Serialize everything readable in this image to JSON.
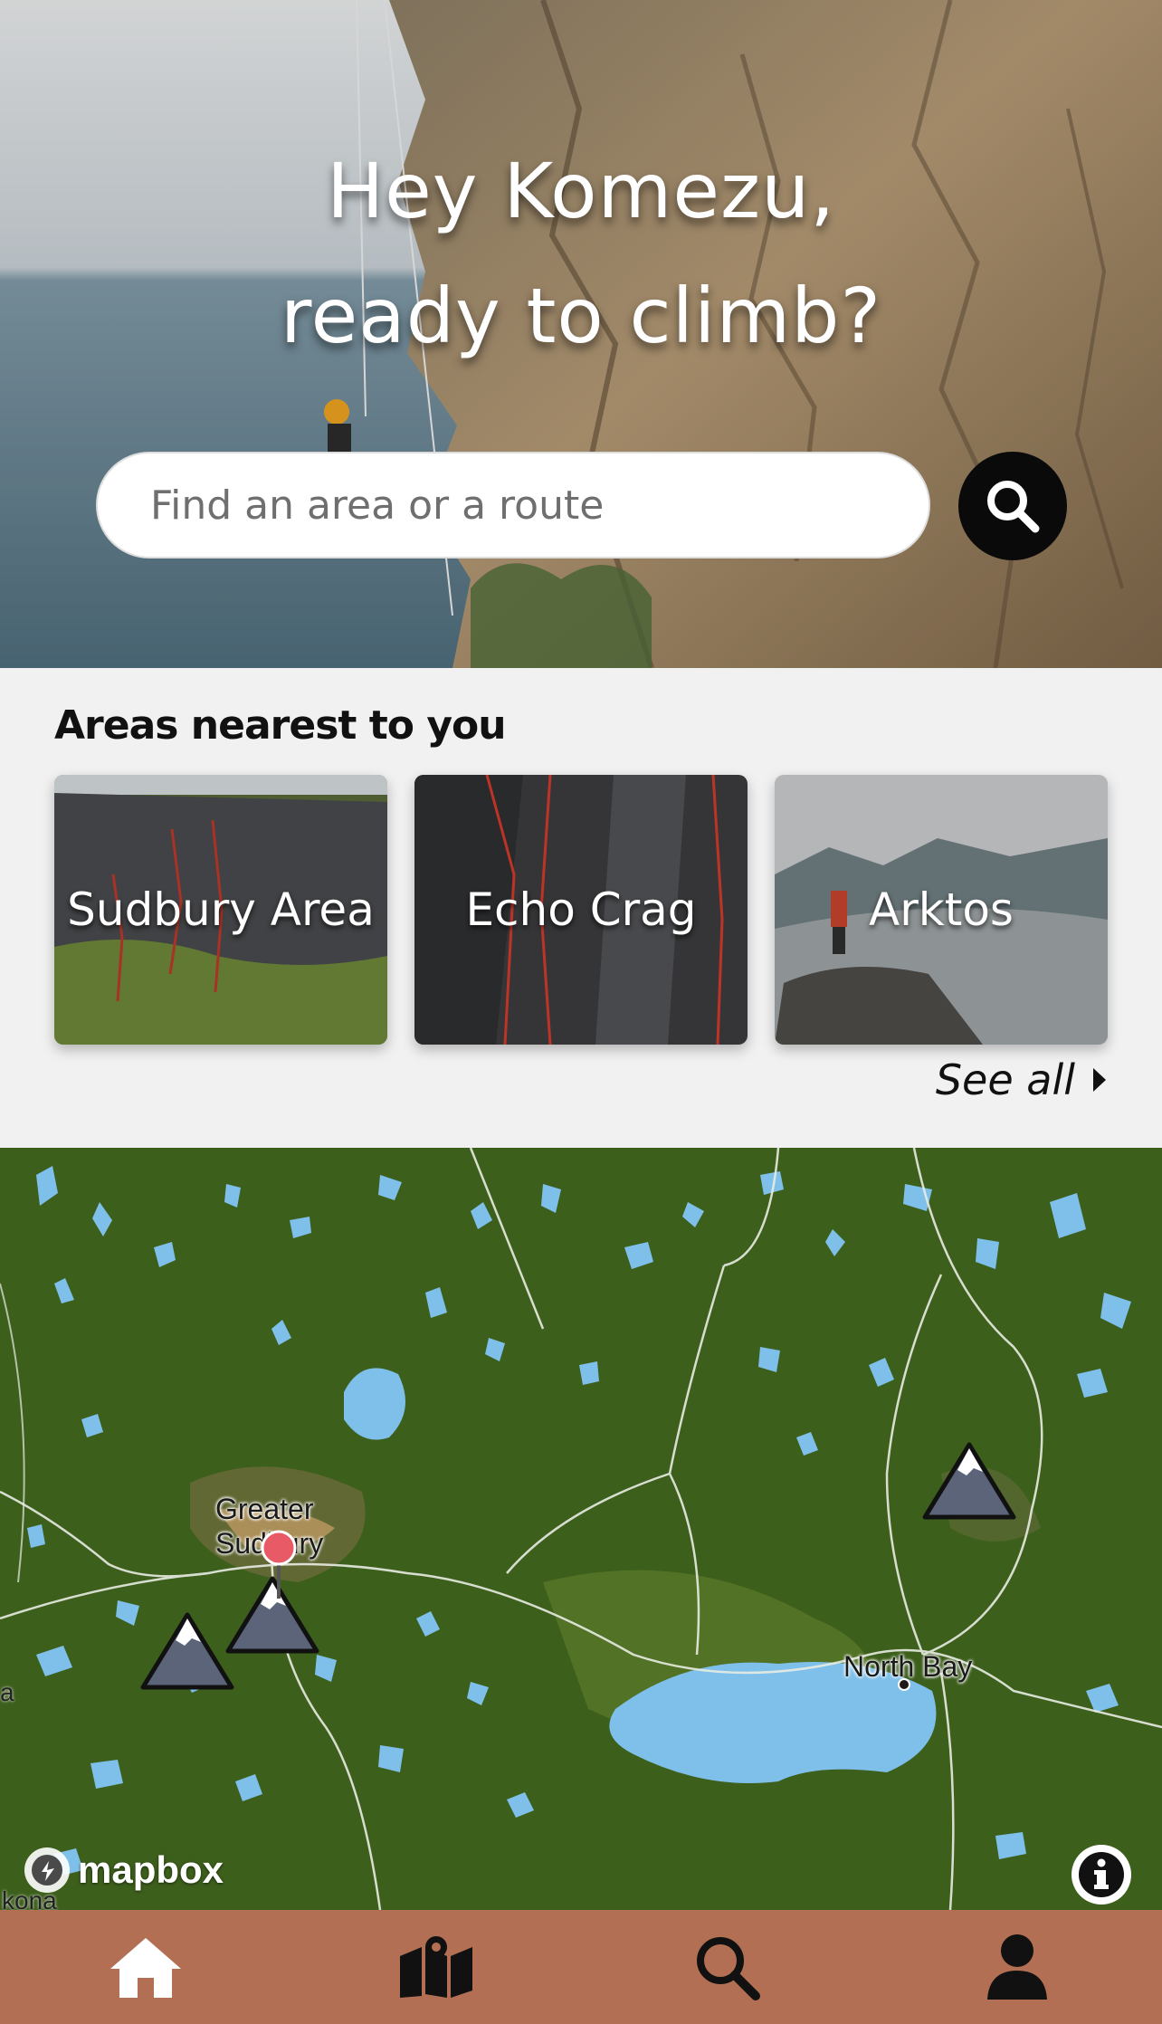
{
  "hero": {
    "greeting_line1": "Hey Komezu,",
    "greeting_line2": "ready to climb?",
    "search_placeholder": "Find an area or a route",
    "search_icon": "search-icon"
  },
  "nearest": {
    "title": "Areas nearest to you",
    "areas": [
      {
        "name": "Sudbury Area"
      },
      {
        "name": "Echo Crag"
      },
      {
        "name": "Arktos"
      }
    ],
    "see_all": "See all"
  },
  "map": {
    "labels": {
      "greater_sudbury": "Greater\nSudbury",
      "north_bay": "North Bay",
      "edge_left": "a",
      "edge_bottom": "kona"
    },
    "attribution": "mapbox",
    "colors": {
      "land": "#3d5f1c",
      "water": "#7fc0ea",
      "urban": "#c9a068",
      "marker": "#5b6478"
    }
  },
  "tabbar": {
    "color": "#b26f53",
    "tabs": [
      {
        "icon": "home-icon"
      },
      {
        "icon": "map-icon"
      },
      {
        "icon": "search-icon"
      },
      {
        "icon": "profile-icon"
      }
    ]
  }
}
